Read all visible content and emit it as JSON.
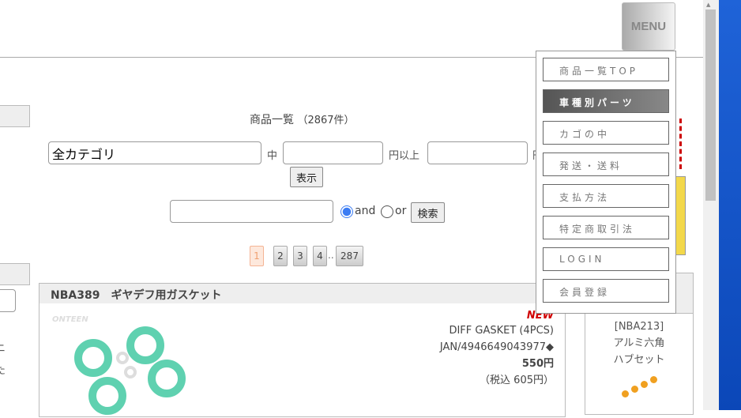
{
  "header": {
    "menu_label": "MENU"
  },
  "main": {
    "title": "商品一覧",
    "count": "（2867件）",
    "category_value": "全カテゴリ",
    "in_label": "中",
    "price_min_label": "円以上",
    "price_max_label_partial": "円",
    "show_button": "表示",
    "keyword_value": "",
    "and_label": "and",
    "or_label": "or",
    "search_button": "検索",
    "search_mode": "and",
    "pages": [
      "1",
      "2",
      "3",
      "4"
    ],
    "ellipsis": "..",
    "last_page": "287",
    "current_page": "1"
  },
  "left_fragments": [
    "ニ",
    "た"
  ],
  "product": {
    "heading": "NBA389　ギヤデフ用ガスケット",
    "brand": "ONTEEN",
    "badge": "NEW",
    "name": "DIFF GASKET (4PCS)",
    "jan": "JAN/4946649043977◆",
    "price": "550円",
    "tax_price": "（税込 605円）"
  },
  "side_product": {
    "code": "[NBA213]",
    "name1": "アルミ六角",
    "name2": "ハブセット"
  },
  "menu": {
    "items": [
      {
        "label": "商品一覧TOP",
        "active": false
      },
      {
        "label": "車種別パーツ",
        "active": true
      },
      {
        "label": "カゴの中",
        "active": false
      },
      {
        "label": "発送・送料",
        "active": false
      },
      {
        "label": "支払方法",
        "active": false
      },
      {
        "label": "特定商取引法",
        "active": false
      },
      {
        "label": "LOGIN",
        "active": false
      },
      {
        "label": "会員登録",
        "active": false
      }
    ]
  },
  "colors": {
    "badge": "#d00000",
    "accent_ring": "#5fd1b0",
    "desktop": "#1f63d8"
  }
}
